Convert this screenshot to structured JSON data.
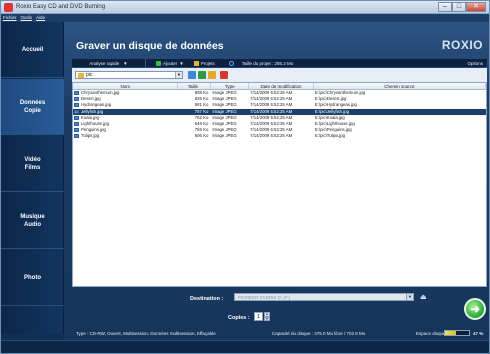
{
  "window": {
    "title": "Roxio Easy CD and DVD Burning",
    "menu": [
      "Fichier",
      "Outils",
      "Aide"
    ],
    "controls": {
      "minimize": "–",
      "maximize": "□",
      "close": "✕"
    }
  },
  "sidebar": {
    "items": [
      {
        "label": "Accueil",
        "active": false
      },
      {
        "label": "Données\nCopie",
        "active": true
      },
      {
        "label": "Vidéo\nFilms",
        "active": false
      },
      {
        "label": "Musique\nAudio",
        "active": false
      },
      {
        "label": "Photo",
        "active": false
      }
    ]
  },
  "main": {
    "title": "Graver un disque de données",
    "brand": "ROXIO"
  },
  "toolbar": {
    "analyze_label": "Analyse rapide",
    "add_label": "Ajouter",
    "projects_label": "Projets",
    "project_size": "Taille du projet : 285.3 Mo",
    "options_label": "Options"
  },
  "path": {
    "current": "pic"
  },
  "file_table": {
    "columns": [
      "Nom",
      "Taille",
      "Type",
      "Date de modification",
      "Chemin source"
    ],
    "rows": [
      {
        "name": "Chrysanthemum.jpg",
        "size": "858 Ko",
        "type": "Image JPEG",
        "date": "7/14/2009 5:52:25 AM",
        "path": "E:\\pic\\Chrysanthemum.jpg",
        "selected": false
      },
      {
        "name": "Desert.jpg",
        "size": "826 Ko",
        "type": "Image JPEG",
        "date": "7/14/2009 5:52:25 AM",
        "path": "E:\\pic\\Desert.jpg",
        "selected": false
      },
      {
        "name": "Hydrangeas.jpg",
        "size": "581 Ko",
        "type": "Image JPEG",
        "date": "7/14/2009 5:52:25 AM",
        "path": "E:\\pic\\Hydrangeas.jpg",
        "selected": false
      },
      {
        "name": "Jellyfish.jpg",
        "size": "757 Ko",
        "type": "Image JPEG",
        "date": "7/14/2009 5:52:25 AM",
        "path": "E:\\pic\\Jellyfish.jpg",
        "selected": true
      },
      {
        "name": "Koala.jpg",
        "size": "762 Ko",
        "type": "Image JPEG",
        "date": "7/14/2009 5:52:25 AM",
        "path": "E:\\pic\\Koala.jpg",
        "selected": false
      },
      {
        "name": "Lighthouse.jpg",
        "size": "548 Ko",
        "type": "Image JPEG",
        "date": "7/14/2009 5:52:25 AM",
        "path": "E:\\pic\\Lighthouse.jpg",
        "selected": false
      },
      {
        "name": "Penguins.jpg",
        "size": "759 Ko",
        "type": "Image JPEG",
        "date": "7/14/2009 5:52:25 AM",
        "path": "E:\\pic\\Penguins.jpg",
        "selected": false
      },
      {
        "name": "Tulips.jpg",
        "size": "606 Ko",
        "type": "Image JPEG",
        "date": "7/14/2009 5:52:25 AM",
        "path": "E:\\pic\\Tulips.jpg",
        "selected": false
      }
    ]
  },
  "bottom": {
    "destination_label": "Destination :",
    "destination_value": "PIONEER DVDRW D: (F:)",
    "copies_label": "Copies :",
    "copies_value": "1"
  },
  "status": {
    "disc_info": "Type : CD-RW, Ouvert, Multisession, Données multisession, Effaçable",
    "capacity": "Capacité du disque : 375.0 Mo libre / 702.8 Mo",
    "space_label": "Espace disque :",
    "space_percent": "47 %",
    "space_fraction": 0.47
  },
  "colors": {
    "background": "#0f2f55",
    "accent_selected": "#1c3f6e",
    "burn_button": "#32b34a",
    "meter": "#f6e24a"
  }
}
